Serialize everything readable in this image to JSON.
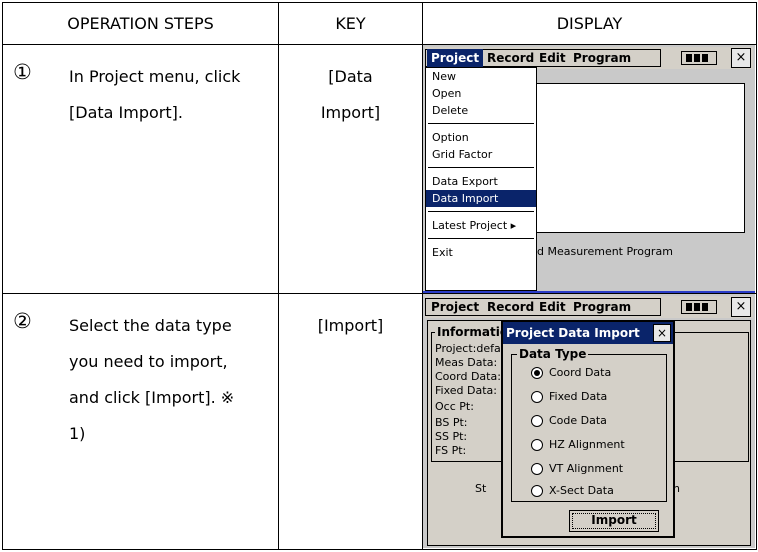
{
  "headers": {
    "steps": "OPERATION STEPS",
    "key": "KEY",
    "display": "DISPLAY"
  },
  "rows": [
    {
      "num": "①",
      "lines": [
        "In Project menu, click",
        "[Data Import]."
      ],
      "key_lines": [
        "[Data",
        "Import]"
      ]
    },
    {
      "num": "②",
      "lines": [
        "Select the data type",
        "you need to import,",
        "and click [Import]. ※",
        "1)"
      ],
      "key_lines": [
        "[Import]"
      ]
    }
  ],
  "screen1": {
    "menubar": [
      "Project",
      "Record",
      "Edit",
      "Program"
    ],
    "close": "×",
    "menu_items": [
      "New",
      "Open",
      "Delete",
      "Option",
      "Grid Factor",
      "Data Export",
      "Data Import",
      "Latest Project ▸",
      "Exit"
    ],
    "status_text": "d Measurement Program"
  },
  "screen2": {
    "menubar": [
      "Project",
      "Record",
      "Edit",
      "Program"
    ],
    "close": "×",
    "info_title": "Information",
    "info_lines": [
      "Project:defau",
      "Meas Data:",
      "Coord Data:",
      "Fixed Data:",
      "Occ Pt:",
      "BS Pt:",
      "SS Pt:",
      "FS Pt:"
    ],
    "bottom_left": "St",
    "bottom_right": "n",
    "dialog_title": "Project Data Import",
    "group_title": "Data Type",
    "options": [
      "Coord Data",
      "Fixed Data",
      "Code Data",
      "HZ Alignment",
      "VT Alignment",
      "X-Sect Data"
    ],
    "selected_index": 0,
    "import_button": "Import"
  },
  "colors": {
    "menu_highlight": "#0a246a",
    "menubar_bg": "#d4d0c8",
    "frame_blue": "#2a3cc8"
  }
}
